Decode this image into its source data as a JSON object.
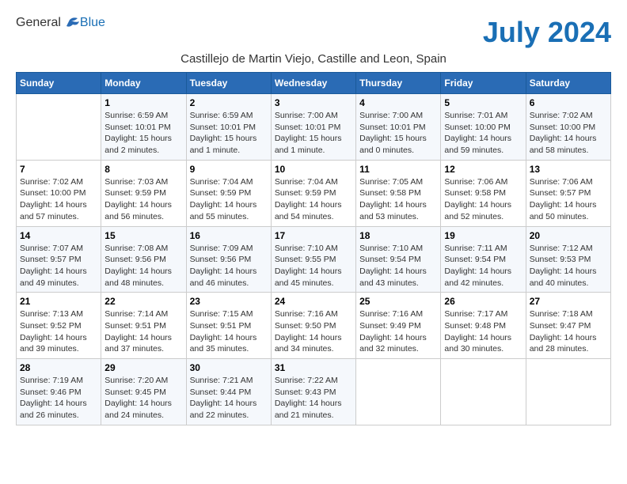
{
  "header": {
    "logo_general": "General",
    "logo_blue": "Blue",
    "month_title": "July 2024",
    "location": "Castillejo de Martin Viejo, Castille and Leon, Spain"
  },
  "columns": [
    "Sunday",
    "Monday",
    "Tuesday",
    "Wednesday",
    "Thursday",
    "Friday",
    "Saturday"
  ],
  "weeks": [
    [
      {
        "day": "",
        "info": ""
      },
      {
        "day": "1",
        "info": "Sunrise: 6:59 AM\nSunset: 10:01 PM\nDaylight: 15 hours\nand 2 minutes."
      },
      {
        "day": "2",
        "info": "Sunrise: 6:59 AM\nSunset: 10:01 PM\nDaylight: 15 hours\nand 1 minute."
      },
      {
        "day": "3",
        "info": "Sunrise: 7:00 AM\nSunset: 10:01 PM\nDaylight: 15 hours\nand 1 minute."
      },
      {
        "day": "4",
        "info": "Sunrise: 7:00 AM\nSunset: 10:01 PM\nDaylight: 15 hours\nand 0 minutes."
      },
      {
        "day": "5",
        "info": "Sunrise: 7:01 AM\nSunset: 10:00 PM\nDaylight: 14 hours\nand 59 minutes."
      },
      {
        "day": "6",
        "info": "Sunrise: 7:02 AM\nSunset: 10:00 PM\nDaylight: 14 hours\nand 58 minutes."
      }
    ],
    [
      {
        "day": "7",
        "info": "Sunrise: 7:02 AM\nSunset: 10:00 PM\nDaylight: 14 hours\nand 57 minutes."
      },
      {
        "day": "8",
        "info": "Sunrise: 7:03 AM\nSunset: 9:59 PM\nDaylight: 14 hours\nand 56 minutes."
      },
      {
        "day": "9",
        "info": "Sunrise: 7:04 AM\nSunset: 9:59 PM\nDaylight: 14 hours\nand 55 minutes."
      },
      {
        "day": "10",
        "info": "Sunrise: 7:04 AM\nSunset: 9:59 PM\nDaylight: 14 hours\nand 54 minutes."
      },
      {
        "day": "11",
        "info": "Sunrise: 7:05 AM\nSunset: 9:58 PM\nDaylight: 14 hours\nand 53 minutes."
      },
      {
        "day": "12",
        "info": "Sunrise: 7:06 AM\nSunset: 9:58 PM\nDaylight: 14 hours\nand 52 minutes."
      },
      {
        "day": "13",
        "info": "Sunrise: 7:06 AM\nSunset: 9:57 PM\nDaylight: 14 hours\nand 50 minutes."
      }
    ],
    [
      {
        "day": "14",
        "info": "Sunrise: 7:07 AM\nSunset: 9:57 PM\nDaylight: 14 hours\nand 49 minutes."
      },
      {
        "day": "15",
        "info": "Sunrise: 7:08 AM\nSunset: 9:56 PM\nDaylight: 14 hours\nand 48 minutes."
      },
      {
        "day": "16",
        "info": "Sunrise: 7:09 AM\nSunset: 9:56 PM\nDaylight: 14 hours\nand 46 minutes."
      },
      {
        "day": "17",
        "info": "Sunrise: 7:10 AM\nSunset: 9:55 PM\nDaylight: 14 hours\nand 45 minutes."
      },
      {
        "day": "18",
        "info": "Sunrise: 7:10 AM\nSunset: 9:54 PM\nDaylight: 14 hours\nand 43 minutes."
      },
      {
        "day": "19",
        "info": "Sunrise: 7:11 AM\nSunset: 9:54 PM\nDaylight: 14 hours\nand 42 minutes."
      },
      {
        "day": "20",
        "info": "Sunrise: 7:12 AM\nSunset: 9:53 PM\nDaylight: 14 hours\nand 40 minutes."
      }
    ],
    [
      {
        "day": "21",
        "info": "Sunrise: 7:13 AM\nSunset: 9:52 PM\nDaylight: 14 hours\nand 39 minutes."
      },
      {
        "day": "22",
        "info": "Sunrise: 7:14 AM\nSunset: 9:51 PM\nDaylight: 14 hours\nand 37 minutes."
      },
      {
        "day": "23",
        "info": "Sunrise: 7:15 AM\nSunset: 9:51 PM\nDaylight: 14 hours\nand 35 minutes."
      },
      {
        "day": "24",
        "info": "Sunrise: 7:16 AM\nSunset: 9:50 PM\nDaylight: 14 hours\nand 34 minutes."
      },
      {
        "day": "25",
        "info": "Sunrise: 7:16 AM\nSunset: 9:49 PM\nDaylight: 14 hours\nand 32 minutes."
      },
      {
        "day": "26",
        "info": "Sunrise: 7:17 AM\nSunset: 9:48 PM\nDaylight: 14 hours\nand 30 minutes."
      },
      {
        "day": "27",
        "info": "Sunrise: 7:18 AM\nSunset: 9:47 PM\nDaylight: 14 hours\nand 28 minutes."
      }
    ],
    [
      {
        "day": "28",
        "info": "Sunrise: 7:19 AM\nSunset: 9:46 PM\nDaylight: 14 hours\nand 26 minutes."
      },
      {
        "day": "29",
        "info": "Sunrise: 7:20 AM\nSunset: 9:45 PM\nDaylight: 14 hours\nand 24 minutes."
      },
      {
        "day": "30",
        "info": "Sunrise: 7:21 AM\nSunset: 9:44 PM\nDaylight: 14 hours\nand 22 minutes."
      },
      {
        "day": "31",
        "info": "Sunrise: 7:22 AM\nSunset: 9:43 PM\nDaylight: 14 hours\nand 21 minutes."
      },
      {
        "day": "",
        "info": ""
      },
      {
        "day": "",
        "info": ""
      },
      {
        "day": "",
        "info": ""
      }
    ]
  ]
}
